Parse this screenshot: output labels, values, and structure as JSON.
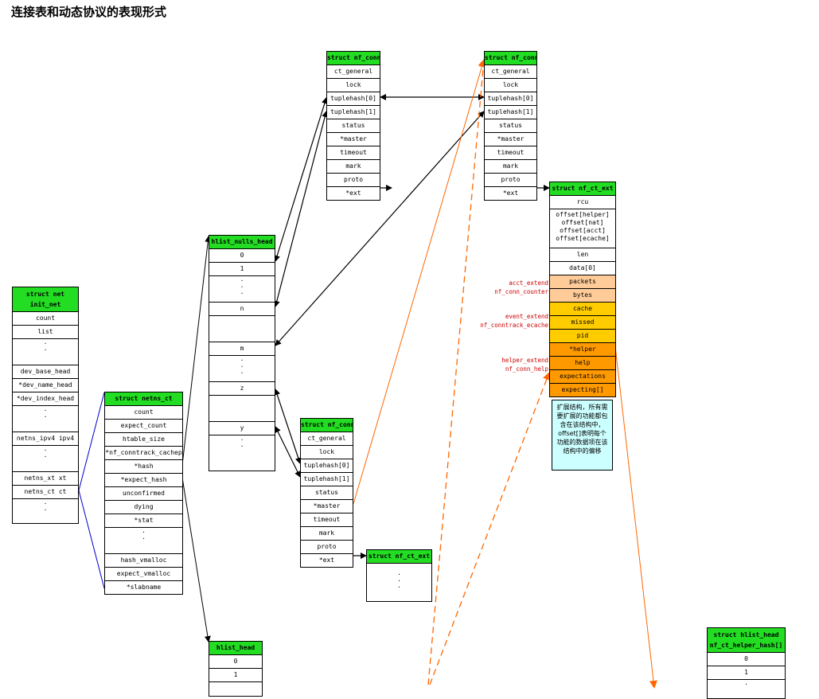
{
  "title": "连接表和动态协议的表现形式",
  "struct_net": {
    "header": [
      "struct net",
      "init_net"
    ],
    "fields": [
      "count",
      "list",
      "dev_base_head",
      "*dev_name_head",
      "*dev_index_head",
      "netns_ipv4  ipv4",
      "netns_xt  xt",
      "netns_ct  ct"
    ]
  },
  "netns_ct": {
    "header": "struct netns_ct",
    "fields": [
      "count",
      "expect_count",
      "htable_size",
      "*nf_conntrack_cachep",
      "*hash",
      "*expect_hash",
      "unconfirmed",
      "dying",
      "*stat",
      "hash_vmalloc",
      "expect_vmalloc",
      "*slabname"
    ]
  },
  "hlist_nulls": {
    "header": "hlist_nulls_head",
    "rows": [
      "0",
      "1",
      "n",
      "m",
      "z",
      "y"
    ]
  },
  "hlist_head": {
    "header": "hlist_head",
    "rows": [
      "0",
      "1"
    ]
  },
  "nf_conn": {
    "header": "struct nf_conn",
    "fields": [
      "ct_general",
      "lock",
      "tuplehash[0]",
      "tuplehash[1]",
      "status",
      "*master",
      "timeout",
      "mark",
      "proto",
      "*ext"
    ]
  },
  "nf_ct_ext_small": {
    "header": "struct nf_ct_ext"
  },
  "nf_ct_ext": {
    "header": "struct nf_ct_ext",
    "rcu": "rcu",
    "offsets": [
      "offset[helper]",
      "offset[nat]",
      "offset[acct]",
      "offset[ecache]"
    ],
    "len": "len",
    "data": "data[0]",
    "acct": [
      "packets",
      "bytes"
    ],
    "ecache": [
      "cache",
      "missed",
      "pid"
    ],
    "help": [
      "*helper",
      "help",
      "expectations",
      "expecting[]"
    ]
  },
  "labels": {
    "acct": [
      "acct_extend",
      "nf_conn_counter"
    ],
    "event": [
      "event_extend",
      "nf_conntrack_ecache"
    ],
    "helper": [
      "helper_extend",
      "nf_conn_help"
    ]
  },
  "note": "扩展结构，所有需要扩展的功能都包含在该结构中，offset[]表明每个功能的数据项在该结构中的偏移",
  "helper_hash": {
    "header": [
      "struct hlist_head",
      "nf_ct_helper_hash[]"
    ],
    "rows": [
      "0",
      "1"
    ]
  },
  "colors": {
    "header_green": "#22dd22",
    "acct_peach": "#ffcc99",
    "ecache_yellow": "#ffcc00",
    "help_orange": "#ff9900",
    "note_cyan": "#ccffff",
    "label_red": "#cc0000",
    "dashed_orange": "#ff6600",
    "link_blue": "#0000cc"
  }
}
